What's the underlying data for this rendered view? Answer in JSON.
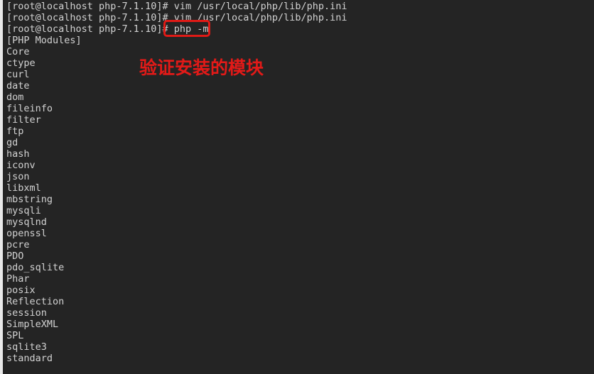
{
  "window": {
    "title": "terminal",
    "background_color": "#242424",
    "foreground_color": "#d2d2d2"
  },
  "annotation": {
    "text": "验证安装的模块",
    "color": "#e21a18",
    "highlight_box_color": "#e01a16",
    "highlighted_command": "php -m"
  },
  "terminal": {
    "prompt": "[root@localhost php-7.1.10]#",
    "lines": [
      "[root@localhost php-7.1.10]# vim /usr/local/php/lib/php.ini",
      "[root@localhost php-7.1.10]# vim /usr/local/php/lib/php.ini",
      "[root@localhost php-7.1.10]# php -m",
      "[PHP Modules]",
      "Core",
      "ctype",
      "curl",
      "date",
      "dom",
      "fileinfo",
      "filter",
      "ftp",
      "gd",
      "hash",
      "iconv",
      "json",
      "libxml",
      "mbstring",
      "mysqli",
      "mysqlnd",
      "openssl",
      "pcre",
      "PDO",
      "pdo_sqlite",
      "Phar",
      "posix",
      "Reflection",
      "session",
      "SimpleXML",
      "SPL",
      "sqlite3",
      "standard"
    ]
  }
}
